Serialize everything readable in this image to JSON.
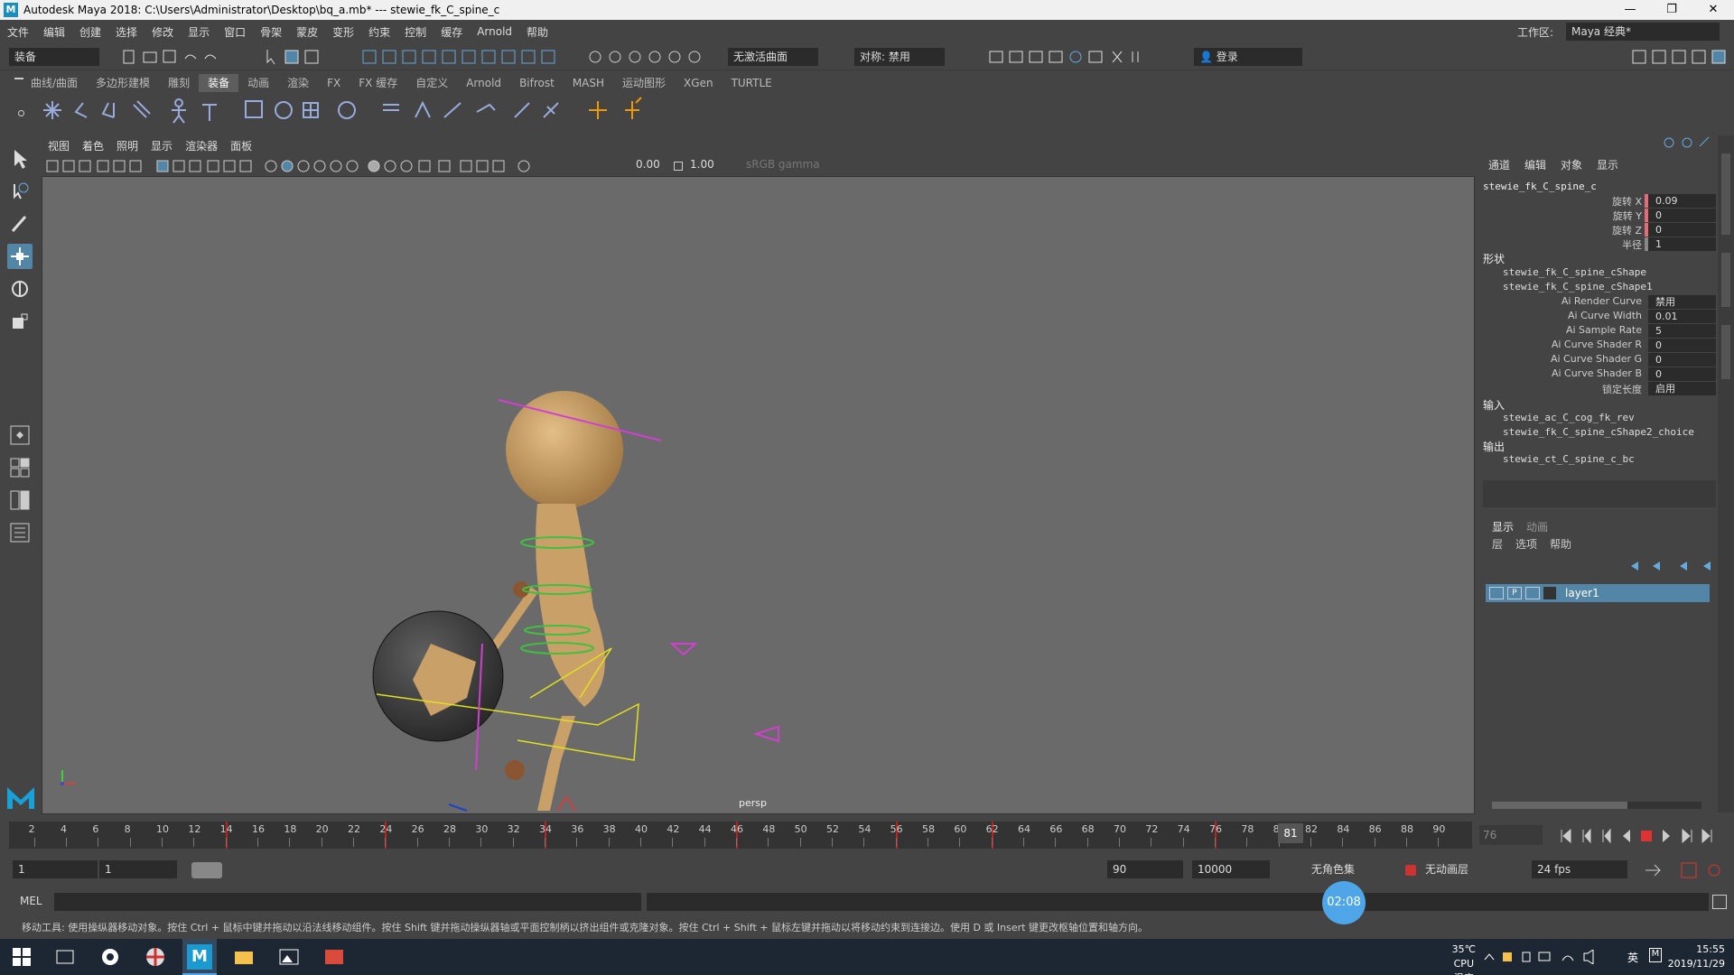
{
  "window": {
    "title": "Autodesk Maya 2018: C:\\Users\\Administrator\\Desktop\\bq_a.mb*   ---   stewie_fk_C_spine_c"
  },
  "menus": [
    "文件",
    "编辑",
    "创建",
    "选择",
    "修改",
    "显示",
    "窗口",
    "骨架",
    "蒙皮",
    "变形",
    "约束",
    "控制",
    "缓存",
    "Arnold",
    "帮助"
  ],
  "workspace": {
    "label": "工作区:",
    "value": "Maya 经典*"
  },
  "statusline": {
    "menuset": "装备",
    "live_surface": "无激活曲面",
    "symmetry": "对称: 禁用",
    "login": "登录"
  },
  "shelf_tabs": [
    "曲线/曲面",
    "多边形建模",
    "雕刻",
    "装备",
    "动画",
    "渲染",
    "FX",
    "FX 缓存",
    "自定义",
    "Arnold",
    "Bifrost",
    "MASH",
    "运动图形",
    "XGen",
    "TURTLE"
  ],
  "shelf_active": "装备",
  "viewport": {
    "menus": [
      "视图",
      "着色",
      "照明",
      "显示",
      "渲染器",
      "面板"
    ],
    "exposure": "0.00",
    "gamma": "1.00",
    "colorspace": "sRGB gamma",
    "camera": "persp"
  },
  "channel_box": {
    "tabs": [
      "通道",
      "编辑",
      "对象",
      "显示"
    ],
    "node": "stewie_fk_C_spine_c",
    "attrs": [
      {
        "label": "旋转 X",
        "value": "0.09"
      },
      {
        "label": "旋转 Y",
        "value": "0"
      },
      {
        "label": "旋转 Z",
        "value": "0"
      },
      {
        "label": "半径",
        "value": "1"
      }
    ],
    "shapes_title": "形状",
    "shapes": [
      "stewie_fk_C_spine_cShape",
      "stewie_fk_C_spine_cShape1"
    ],
    "shape_attrs": [
      {
        "label": "Ai Render Curve",
        "value": "禁用"
      },
      {
        "label": "Ai Curve Width",
        "value": "0.01"
      },
      {
        "label": "Ai Sample Rate",
        "value": "5"
      },
      {
        "label": "Ai Curve Shader R",
        "value": "0"
      },
      {
        "label": "Ai Curve Shader G",
        "value": "0"
      },
      {
        "label": "Ai Curve Shader B",
        "value": "0"
      },
      {
        "label": "锁定长度",
        "value": "启用"
      }
    ],
    "inputs_title": "输入",
    "inputs": [
      "stewie_ac_C_cog_fk_rev",
      "stewie_fk_C_spine_cShape2_choice"
    ],
    "outputs_title": "输出",
    "outputs": [
      "stewie_ct_C_spine_c_bc"
    ]
  },
  "layer_editor": {
    "tabs": [
      "显示",
      "动画"
    ],
    "menus": [
      "层",
      "选项",
      "帮助"
    ],
    "layer": {
      "flags": [
        "V",
        "P"
      ],
      "name": "layer1"
    }
  },
  "timeline": {
    "ticks": [
      2,
      4,
      6,
      8,
      10,
      12,
      14,
      16,
      18,
      20,
      22,
      24,
      26,
      28,
      30,
      32,
      34,
      36,
      38,
      40,
      42,
      44,
      46,
      48,
      50,
      52,
      54,
      56,
      58,
      60,
      62,
      64,
      66,
      68,
      70,
      72,
      74,
      76,
      78,
      80,
      82,
      84,
      86,
      88,
      90
    ],
    "current_frame": "81",
    "current_field": "76"
  },
  "range": {
    "start": "1",
    "start2": "1",
    "end": "90",
    "end2": "10000",
    "char_set": "无角色集",
    "anim_layer": "无动画层",
    "fps": "24 fps"
  },
  "cmdline": {
    "label": "MEL"
  },
  "helpline": "移动工具: 使用操纵器移动对象。按住 Ctrl + 鼠标中键并拖动以沿法线移动组件。按住 Shift 键并拖动操纵器轴或平面控制柄以挤出组件或克隆对象。按住 Ctrl + Shift + 鼠标左键并拖动以将移动约束到连接边。使用 D 或 Insert 键更改枢轴位置和轴方向。",
  "timer": "02:08",
  "taskbar": {
    "temp": "35℃",
    "temp_label": "CPU温度",
    "ime": "英",
    "time": "15:55",
    "date": "2019/11/29"
  }
}
